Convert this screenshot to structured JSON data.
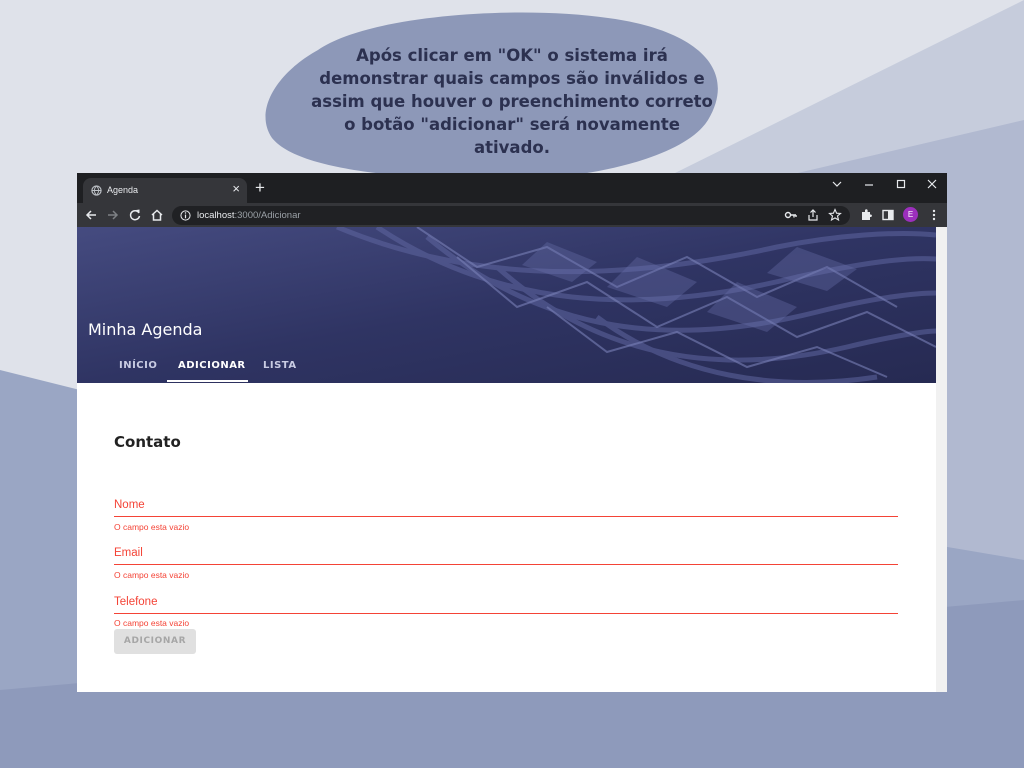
{
  "caption": {
    "lines": [
      "Após clicar em \"OK\" o sistema irá",
      "demonstrar quais campos são inválidos e",
      "assim que houver o preenchimento correto",
      "o botão \"adicionar\" será novamente",
      "ativado."
    ]
  },
  "browser": {
    "tab_title": "Agenda",
    "tab_close": "×",
    "new_tab": "+",
    "url_host": "localhost",
    "url_path": ":3000/Adicionar",
    "profile_initial": "E"
  },
  "app": {
    "title": "Minha Agenda",
    "nav": [
      "INÍCIO",
      "ADICIONAR",
      "LISTA"
    ],
    "active_nav": "ADICIONAR"
  },
  "form": {
    "title": "Contato",
    "fields": [
      {
        "label": "Nome",
        "error": "O campo esta vazio"
      },
      {
        "label": "Email",
        "error": "O campo esta vazio"
      },
      {
        "label": "Telefone",
        "error": "O campo esta vazio"
      }
    ],
    "submit_label": "ADICIONAR",
    "submit_disabled": true
  },
  "colors": {
    "error": "#f44336",
    "hero": "#34396a",
    "chrome_dark": "#1e1f22",
    "chrome_toolbar": "#35363a",
    "bubble": "#8d98b8",
    "profile": "#9c2fbd"
  },
  "icons": [
    "globe-icon",
    "back-icon",
    "forward-icon",
    "reload-icon",
    "home-icon",
    "info-icon",
    "key-icon",
    "share-icon",
    "star-icon",
    "extensions-icon",
    "side-panel-icon",
    "menu-icon",
    "minimize-icon",
    "maximize-icon",
    "close-icon",
    "tab-list-icon"
  ]
}
